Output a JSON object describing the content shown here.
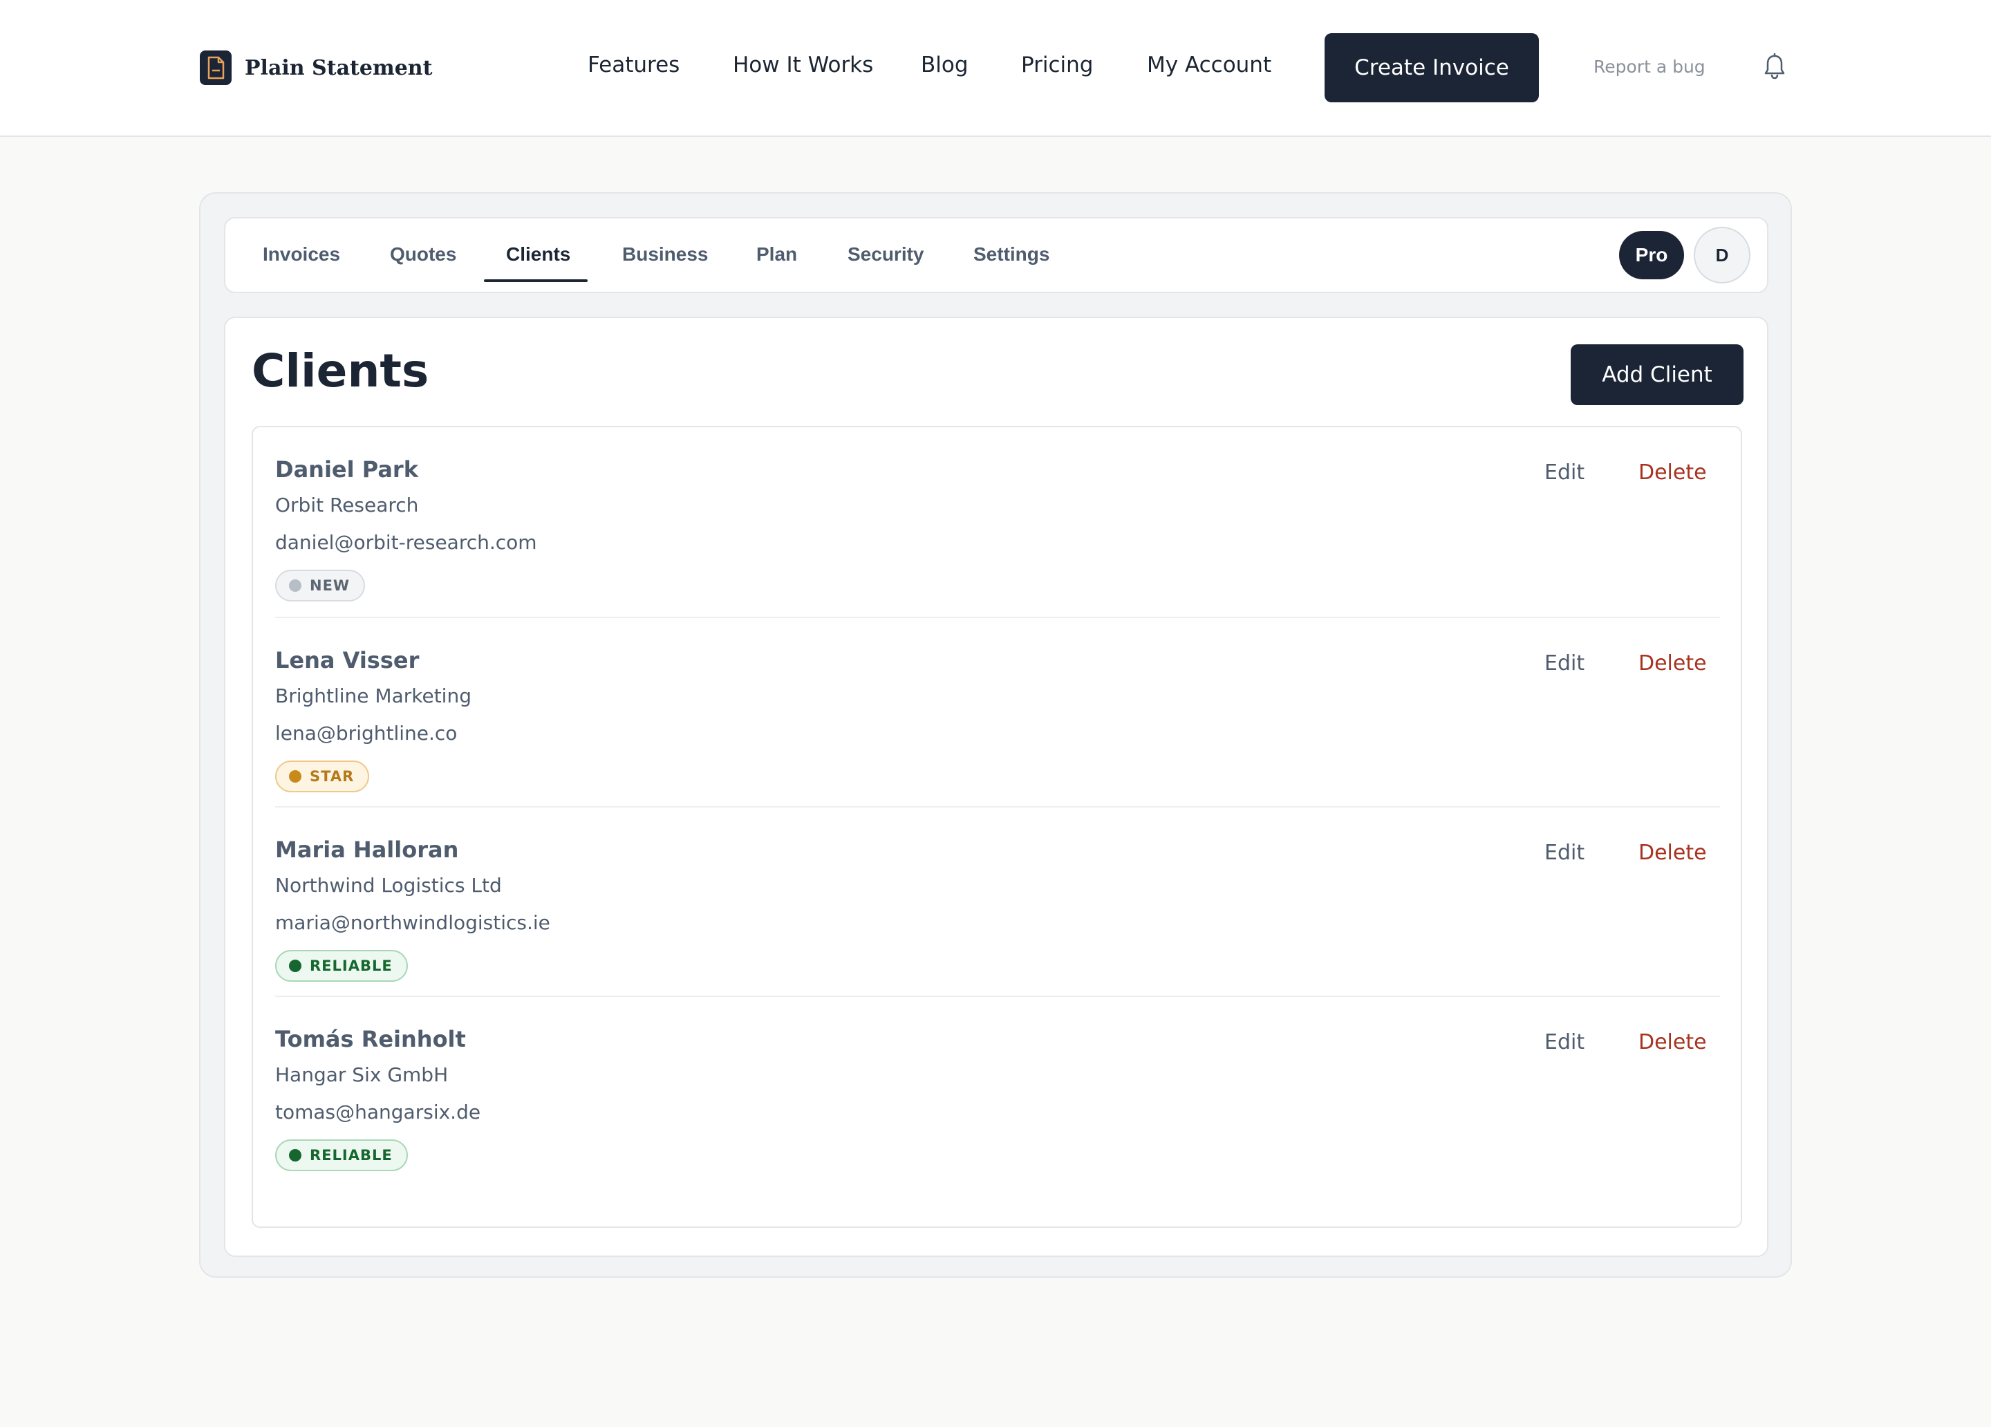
{
  "brand": {
    "name": "Plain Statement",
    "icon": "document-icon"
  },
  "nav": {
    "links": [
      "Features",
      "How It Works",
      "Blog",
      "Pricing",
      "My Account"
    ],
    "cta_label": "Create Invoice",
    "bug_label": "Report a bug",
    "bell_icon": "bell-icon"
  },
  "tabs": {
    "items": [
      "Invoices",
      "Quotes",
      "Clients",
      "Business",
      "Plan",
      "Security",
      "Settings"
    ],
    "active": "Clients",
    "plan_badge": "Pro",
    "avatar_initial": "D"
  },
  "page": {
    "title": "Clients",
    "add_button": "Add Client"
  },
  "clients": [
    {
      "name": "Daniel Park",
      "company": "Orbit Research",
      "email": "daniel@orbit-research.com",
      "tag": "NEW"
    },
    {
      "name": "Lena Visser",
      "company": "Brightline Marketing",
      "email": "lena@brightline.co",
      "tag": "STAR"
    },
    {
      "name": "Maria Halloran",
      "company": "Northwind Logistics Ltd",
      "email": "maria@northwindlogistics.ie",
      "tag": "RELIABLE"
    },
    {
      "name": "Tomás Reinholt",
      "company": "Hangar Six GmbH",
      "email": "tomas@hangarsix.de",
      "tag": "RELIABLE"
    }
  ],
  "row_actions": {
    "edit": "Edit",
    "delete": "Delete"
  },
  "tag_colors": {
    "NEW": {
      "bg": "#f3f4f6",
      "border": "#d8dce2",
      "dot": "#b8bec8",
      "text": "#5b6573"
    },
    "STAR": {
      "bg": "#fdf5e2",
      "border": "#efc98a",
      "dot": "#c98a1a",
      "text": "#b5791a"
    },
    "RELIABLE": {
      "bg": "#edf8f0",
      "border": "#a8d8b6",
      "dot": "#16672f",
      "text": "#16672f"
    }
  },
  "colors": {
    "primary": "#1b2535",
    "danger": "#a8321e",
    "muted": "#4f5c6e"
  }
}
